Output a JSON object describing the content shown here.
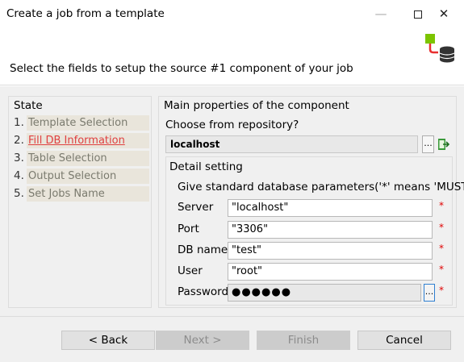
{
  "window": {
    "title": "Create a job from a template",
    "controls": {
      "minimize": "—",
      "close": "✕"
    }
  },
  "header": {
    "subtitle": "Select the fields to setup the source #1 component of your job"
  },
  "state": {
    "title": "State",
    "steps": [
      {
        "num": "1.",
        "label": "Template Selection",
        "active": false
      },
      {
        "num": "2.",
        "label": "Fill DB Information",
        "active": true
      },
      {
        "num": "3.",
        "label": "Table Selection",
        "active": false
      },
      {
        "num": "4.",
        "label": "Output Selection",
        "active": false
      },
      {
        "num": "5.",
        "label": "Set Jobs Name",
        "active": false
      }
    ]
  },
  "main": {
    "title": "Main properties of the component",
    "repo_label": "Choose from repository?",
    "repo_value": "localhost",
    "repo_button": "...",
    "detail": {
      "title": "Detail setting",
      "description": "Give standard database parameters('*' means 'MUST')",
      "fields": {
        "server": {
          "label": "Server",
          "value": "\"localhost\"",
          "required": "*"
        },
        "port": {
          "label": "Port",
          "value": "\"3306\"",
          "required": "*"
        },
        "dbname": {
          "label": "DB name",
          "value": "\"test\"",
          "required": "*"
        },
        "user": {
          "label": "User",
          "value": "\"root\"",
          "required": "*"
        },
        "password": {
          "label": "Password",
          "value": "●●●●●●",
          "button": "...",
          "required": "*"
        }
      }
    }
  },
  "footer": {
    "back": "< Back",
    "next": "Next >",
    "finish": "Finish",
    "cancel": "Cancel"
  },
  "colors": {
    "active_step": "#e04040",
    "required_marker": "#e00000",
    "panel_background": "#f0f0f0"
  }
}
